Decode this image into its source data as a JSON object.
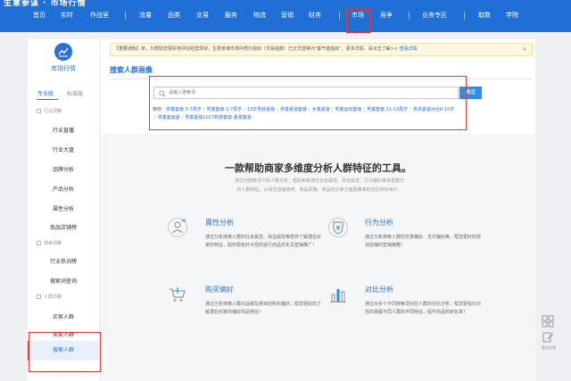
{
  "brand": {
    "logo_text": "生意参谋 · 市场行情"
  },
  "nav": {
    "items": [
      "首页",
      "实时",
      "作战室",
      "流量",
      "品类",
      "交易",
      "服务",
      "物流",
      "营销",
      "财务",
      "市场",
      "竞争",
      "业务专区",
      "取数",
      "学院"
    ],
    "active": "市场"
  },
  "sidebar": {
    "title": "市场行情",
    "tabs": [
      "专业版",
      "标准版"
    ],
    "groups": [
      {
        "label": "行业洞察",
        "items": [
          "行业直播",
          "行业大盘",
          "品牌分析",
          "产品分析",
          "属性分析",
          "商品店铺榜"
        ]
      },
      {
        "label": "搜索洞察",
        "items": [
          "行业热词榜",
          "搜索词查询"
        ]
      },
      {
        "label": "人群洞察",
        "items": [
          "买家人群",
          "卖家人群",
          "搜索人群"
        ]
      }
    ],
    "active_item": "搜索人群"
  },
  "notice": {
    "text": "【重要通知】亲，为帮助您更好地评估经营现状，生意参谋市场中部分指标（交易指数）已正式替换为\"客气值指标\"，更多详情，请点击了解>>",
    "link": "查看详情",
    "close": "×"
  },
  "page": {
    "title": "搜索人群画像"
  },
  "search": {
    "placeholder": "请输入搜索词",
    "button": "确定"
  },
  "suggest": {
    "label": "推荐：",
    "items": [
      "男童套装 5-7周岁",
      "男童套装 3-7周岁",
      "13岁男孩夏装",
      "男童夏装套装",
      "女童夏装",
      "男童运动套装",
      "男童套装 11-13周岁",
      "男孩夏装冰丝8-10岁",
      "男童套装夏",
      "男童夏装2017新款套装 夏装童装"
    ]
  },
  "intro": {
    "title": "一款帮助商家多维度分析人群特征的工具。",
    "desc": "通过对搜索词下的人群分析，帮助卖家通过社会属性、淘宝属性、行为偏好等多视角分析人群特征，从而在店铺装修、商品风格、商品定价等方面更精准的定位目标用户。"
  },
  "features": [
    {
      "icon": "person-icon",
      "title": "属性分析",
      "desc": "通过分析搜索人群的社会属性、淘宝属性等帮你了解潜在买家的特征，助你更有针对性的进行商品优化及营销推广！"
    },
    {
      "icon": "shield-icon",
      "title": "行为分析",
      "desc": "通过分析搜索人群的优惠偏好、支付偏好等，帮您更好的规划店铺的营销策略！"
    },
    {
      "icon": "cart-icon",
      "title": "购买偏好",
      "desc": "通过分析搜索人群对品牌及类目的购买偏好，帮您更好的了解潜在买家的偏好商品特征！"
    },
    {
      "icon": "bar-chart-icon",
      "title": "对比分析",
      "desc": "通过对多个不同搜索词对应人群的对比分析，帮您更有针对性的掌握不同人群的不同特征，提升商品的转化率！"
    }
  ],
  "float_tools": {
    "feedback_label": "意见反馈"
  },
  "colors": {
    "nav_bg": "#1f6fd6",
    "accent": "#2c6fd6",
    "highlight_box": "#e53935"
  }
}
